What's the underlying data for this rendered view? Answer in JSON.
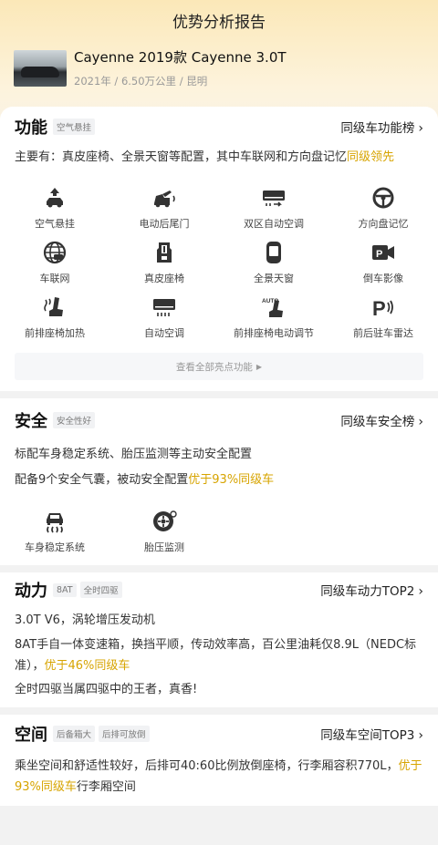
{
  "header": {
    "title": "优势分析报告"
  },
  "car": {
    "title": "Cayenne 2019款 Cayenne 3.0T",
    "meta": "2021年 / 6.50万公里 / 昆明"
  },
  "function_section": {
    "title": "功能",
    "tag": "空气悬挂",
    "link": "同级车功能榜",
    "desc_plain": "主要有：真皮座椅、全景天窗等配置，其中车联网和方向盘记忆",
    "desc_highlight": "同级领先",
    "features": [
      {
        "label": "空气悬挂",
        "icon": "air-suspension-icon"
      },
      {
        "label": "电动后尾门",
        "icon": "power-tailgate-icon"
      },
      {
        "label": "双区自动空调",
        "icon": "dual-zone-ac-icon"
      },
      {
        "label": "方向盘记忆",
        "icon": "steering-memory-icon"
      },
      {
        "label": "车联网",
        "icon": "connected-car-icon"
      },
      {
        "label": "真皮座椅",
        "icon": "leather-seat-icon"
      },
      {
        "label": "全景天窗",
        "icon": "panoramic-sunroof-icon"
      },
      {
        "label": "倒车影像",
        "icon": "reverse-camera-icon"
      },
      {
        "label": "前排座椅加热",
        "icon": "seat-heating-icon"
      },
      {
        "label": "自动空调",
        "icon": "auto-ac-icon"
      },
      {
        "label": "前排座椅电动调节",
        "icon": "power-seat-adjust-icon"
      },
      {
        "label": "前后驻车雷达",
        "icon": "parking-radar-icon"
      }
    ],
    "more_label": "查看全部亮点功能"
  },
  "safety_section": {
    "title": "安全",
    "tag": "安全性好",
    "link": "同级车安全榜",
    "desc1": "标配车身稳定系统、胎压监测等主动安全配置",
    "desc2_plain": "配备9个安全气囊，被动安全配置",
    "desc2_highlight": "优于93%同级车",
    "features": [
      {
        "label": "车身稳定系统",
        "icon": "stability-control-icon"
      },
      {
        "label": "胎压监测",
        "icon": "tire-pressure-icon"
      }
    ]
  },
  "power_section": {
    "title": "动力",
    "tags": [
      "8AT",
      "全时四驱"
    ],
    "link": "同级车动力TOP2",
    "desc1": "3.0T V6，涡轮增压发动机",
    "desc2_plain": "8AT手自一体变速箱，换挡平顺，传动效率高，百公里油耗仅8.9L（NEDC标准），",
    "desc2_highlight": "优于46%同级车",
    "desc3": "全时四驱当属四驱中的王者，真香!"
  },
  "space_section": {
    "title": "空间",
    "tags": [
      "后备箱大",
      "后排可放倒"
    ],
    "link": "同级车空间TOP3",
    "desc_plain": "乘坐空间和舒适性较好，后排可40:60比例放倒座椅，行李厢容积770L，",
    "desc_highlight": "优于93%同级车",
    "desc_tail": "行李厢空间"
  },
  "colors": {
    "accent": "#d7a400",
    "header_bg": "#fbe8b8"
  }
}
